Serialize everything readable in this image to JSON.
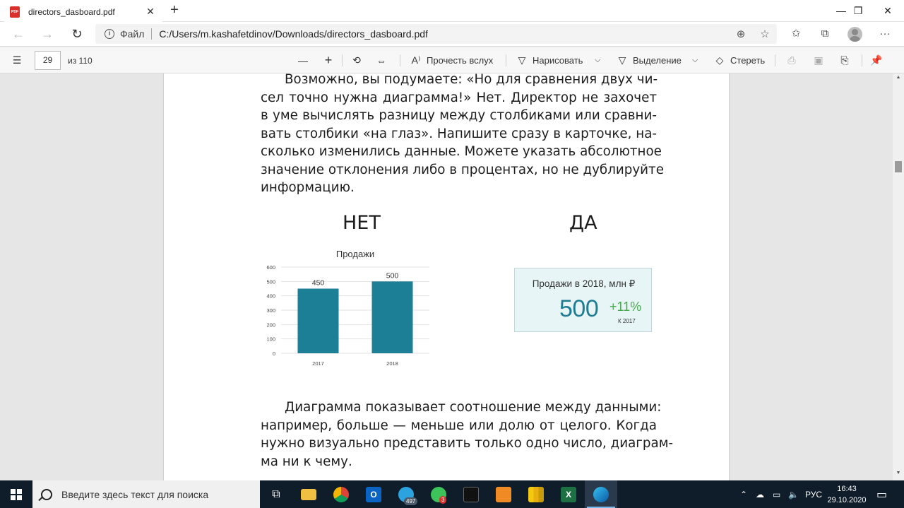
{
  "browser": {
    "tab_title": "directors_dasboard.pdf",
    "tab_close": "✕",
    "new_tab": "+",
    "window_controls": {
      "minimize": "—",
      "maximize": "❐",
      "close": "✕"
    },
    "scheme_label": "Файл",
    "url": "C:/Users/m.kashafetdinov/Downloads/directors_dasboard.pdf"
  },
  "pdf_toolbar": {
    "page_current": "29",
    "page_total": "из 110",
    "read_aloud": "Прочесть вслух",
    "draw": "Нарисовать",
    "highlight": "Выделение",
    "erase": "Стереть"
  },
  "document": {
    "para1_lines": [
      "Возможно, вы подумаете: «Но для сравнения двух чи-",
      "сел точно нужна диаграмма!» Нет. Директор не захочет",
      "в уме вычислять разницу между столбиками или сравни-",
      "вать столбики «на глаз». Напишите сразу в карточке, на-",
      "сколько изменились данные. Можете указать абсолютное",
      "значение отклонения либо в процентах, но не дублируйте",
      "информацию."
    ],
    "heading_no": "НЕТ",
    "heading_yes": "ДА",
    "kpi": {
      "title": "Продажи в 2018, млн ₽",
      "value": "500",
      "delta": "+11%",
      "reference": "К 2017"
    },
    "para2_lines": [
      "Диаграмма показывает соотношение между данными:",
      "например, больше — меньше или долю от целого. Когда",
      "нужно визуально представить только одно число, диаграм-",
      "ма ни к чему."
    ]
  },
  "chart_data": {
    "type": "bar",
    "title": "Продажи",
    "categories": [
      "2017",
      "2018"
    ],
    "values": [
      450,
      500
    ],
    "data_labels": [
      "450",
      "500"
    ],
    "ylim": [
      0,
      600
    ],
    "yticks": [
      "0",
      "100",
      "200",
      "300",
      "400",
      "500",
      "600"
    ],
    "grid": true,
    "bar_color": "#1d7f96"
  },
  "taskbar": {
    "search_placeholder": "Введите здесь текст для поиска",
    "telegram_badge": "497",
    "whatsapp_badge": "3",
    "language": "РУС",
    "time": "16:43",
    "date": "29.10.2020"
  },
  "colors": {
    "kpi_value": "#1f7d93",
    "kpi_delta": "#46a84b",
    "kpi_bg": "#e8f5f6"
  }
}
